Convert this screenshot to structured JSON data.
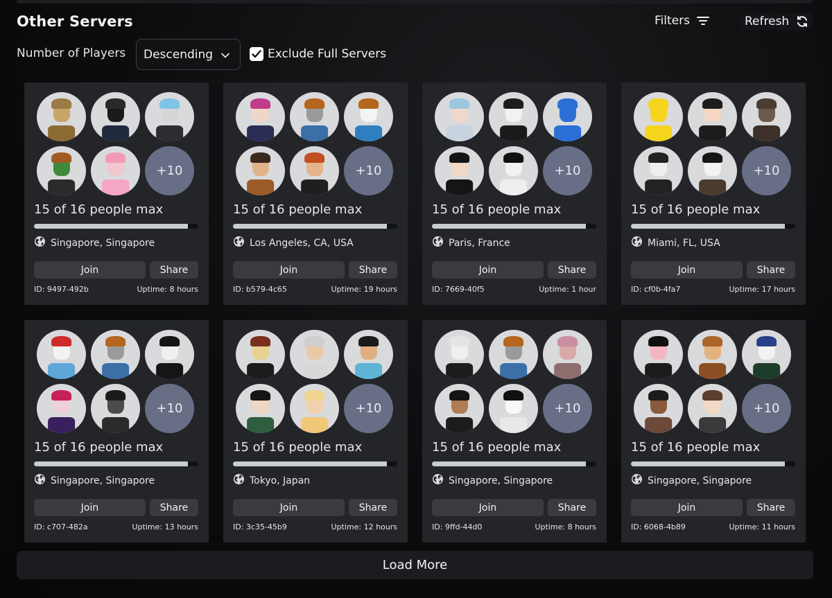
{
  "header": {
    "title": "Other Servers",
    "filters_label": "Filters",
    "refresh_label": "Refresh"
  },
  "sort": {
    "label": "Number of Players",
    "value": "Descending"
  },
  "exclude_full": {
    "label": "Exclude Full Servers",
    "checked": true
  },
  "servers": [
    {
      "people": "15 of 16 people max",
      "fill": 0.9375,
      "location": "Singapore, Singapore",
      "join": "Join",
      "share": "Share",
      "id": "ID: 9497-492b",
      "uptime": "Uptime: 8 hours",
      "more": "+10",
      "avatars": [
        {
          "skin": "#c9a56a",
          "hair": "#9b7a43",
          "body": "#8c6b35"
        },
        {
          "skin": "#1a1a1a",
          "hair": "#2a2a2a",
          "body": "#1f2a3d"
        },
        {
          "skin": "#d5d6d8",
          "hair": "#7fc3e8",
          "body": "#2b2d33"
        },
        {
          "skin": "#3f8a3a",
          "hair": "#a05a22",
          "body": "#2b2b2b"
        },
        {
          "skin": "#f1c6cf",
          "hair": "#f29ab8",
          "body": "#f5a6c4"
        }
      ]
    },
    {
      "people": "15 of 16 people max",
      "fill": 0.9375,
      "location": "Los Angeles, CA, USA",
      "join": "Join",
      "share": "Share",
      "id": "ID: b579-4c65",
      "uptime": "Uptime: 19 hours",
      "more": "+10",
      "avatars": [
        {
          "skin": "#f0d6c8",
          "hair": "#c23a8a",
          "body": "#2b2d55"
        },
        {
          "skin": "#9a9a9a",
          "hair": "#b5651d",
          "body": "#3a6fa8"
        },
        {
          "skin": "#f4f4f4",
          "hair": "#b5651d",
          "body": "#2f7fc0"
        },
        {
          "skin": "#e2b38a",
          "hair": "#3b2a1c",
          "body": "#9b5a2a"
        },
        {
          "skin": "#e6b48b",
          "hair": "#c0501f",
          "body": "#1f1f1f"
        }
      ]
    },
    {
      "people": "15 of 16 people max",
      "fill": 0.9375,
      "location": "Paris, France",
      "join": "Join",
      "share": "Share",
      "id": "ID: 7669-40f5",
      "uptime": "Uptime: 1 hour",
      "more": "+10",
      "avatars": [
        {
          "skin": "#f0d9cc",
          "hair": "#9ac6de",
          "body": "#c9d3e0"
        },
        {
          "skin": "#f2f2f2",
          "hair": "#1d1d1d",
          "body": "#1a1a1a"
        },
        {
          "skin": "#2c6fd6",
          "hair": "#2c6fd6",
          "body": "#2c6fd6"
        },
        {
          "skin": "#f1d7c4",
          "hair": "#151515",
          "body": "#151515"
        },
        {
          "skin": "#f2f2f2",
          "hair": "#111111",
          "body": "#eeeeee"
        }
      ]
    },
    {
      "people": "15 of 16 people max",
      "fill": 0.9375,
      "location": "Miami, FL, USA",
      "join": "Join",
      "share": "Share",
      "id": "ID: cf0b-4fa7",
      "uptime": "Uptime: 17 hours",
      "more": "+10",
      "avatars": [
        {
          "skin": "#f5d51e",
          "hair": "#f5d51e",
          "body": "#f5d51e"
        },
        {
          "skin": "#f4d6c2",
          "hair": "#1d1d1d",
          "body": "#1c1c1c"
        },
        {
          "skin": "#6b5a4a",
          "hair": "#4a3d32",
          "body": "#3c3028"
        },
        {
          "skin": "#efefef",
          "hair": "#232323",
          "body": "#232323"
        },
        {
          "skin": "#f2f2f2",
          "hair": "#151515",
          "body": "#4a3b2e"
        }
      ]
    },
    {
      "people": "15 of 16 people max",
      "fill": 0.9375,
      "location": "Singapore, Singapore",
      "join": "Join",
      "share": "Share",
      "id": "ID: c707-482a",
      "uptime": "Uptime: 13 hours",
      "more": "+10",
      "avatars": [
        {
          "skin": "#f3f3f3",
          "hair": "#d02b2b",
          "body": "#5fa6d9"
        },
        {
          "skin": "#9a9a9a",
          "hair": "#b5651d",
          "body": "#3a6fa8"
        },
        {
          "skin": "#f0f0f0",
          "hair": "#151515",
          "body": "#151515"
        },
        {
          "skin": "#f0d0d8",
          "hair": "#c81f5a",
          "body": "#3a1f5e"
        },
        {
          "skin": "#4b4b4b",
          "hair": "#1b1b1b",
          "body": "#2b2b2b"
        }
      ]
    },
    {
      "people": "15 of 16 people max",
      "fill": 0.9375,
      "location": "Tokyo, Japan",
      "join": "Join",
      "share": "Share",
      "id": "ID: 3c35-45b9",
      "uptime": "Uptime: 12 hours",
      "more": "+10",
      "avatars": [
        {
          "skin": "#e9d28f",
          "hair": "#7a2e1e",
          "body": "#1c1c1c"
        },
        {
          "skin": "#eac9a8",
          "hair": "#cfcfcf",
          "body": "#d8d8d8"
        },
        {
          "skin": "#e0b080",
          "hair": "#1a1a1a",
          "body": "#5fb3d5"
        },
        {
          "skin": "#f1d6c2",
          "hair": "#151515",
          "body": "#2e5e3e"
        },
        {
          "skin": "#f1d1ad",
          "hair": "#f0d58f",
          "body": "#f0c878"
        }
      ]
    },
    {
      "people": "15 of 16 people max",
      "fill": 0.9375,
      "location": "Singapore, Singapore",
      "join": "Join",
      "share": "Share",
      "id": "ID: 9ffd-44d0",
      "uptime": "Uptime: 8 hours",
      "more": "+10",
      "avatars": [
        {
          "skin": "#efefef",
          "hair": "#e4e4e4",
          "body": "#1c1c1c"
        },
        {
          "skin": "#9a9a9a",
          "hair": "#b5651d",
          "body": "#3a6fa8"
        },
        {
          "skin": "#d9a8a8",
          "hair": "#c98fa0",
          "body": "#8e6d6d"
        },
        {
          "skin": "#b27c52",
          "hair": "#151515",
          "body": "#1c1c1c"
        },
        {
          "skin": "#f7f7f7",
          "hair": "#111111",
          "body": "#e8e8e8"
        }
      ]
    },
    {
      "people": "15 of 16 people max",
      "fill": 0.9375,
      "location": "Singapore, Singapore",
      "join": "Join",
      "share": "Share",
      "id": "ID: 6068-4b89",
      "uptime": "Uptime: 11 hours",
      "more": "+10",
      "avatars": [
        {
          "skin": "#f4b6c2",
          "hair": "#111111",
          "body": "#1c1c1c"
        },
        {
          "skin": "#e3b27e",
          "hair": "#a9652a",
          "body": "#8b4f23"
        },
        {
          "skin": "#f2f2f2",
          "hair": "#2a3f8a",
          "body": "#1d3d2a"
        },
        {
          "skin": "#8a5a3a",
          "hair": "#1c1c1c",
          "body": "#6b4a3a"
        },
        {
          "skin": "#f2d9c4",
          "hair": "#5a3f2c",
          "body": "#3a3a3a"
        }
      ]
    }
  ],
  "load_more_label": "Load More"
}
